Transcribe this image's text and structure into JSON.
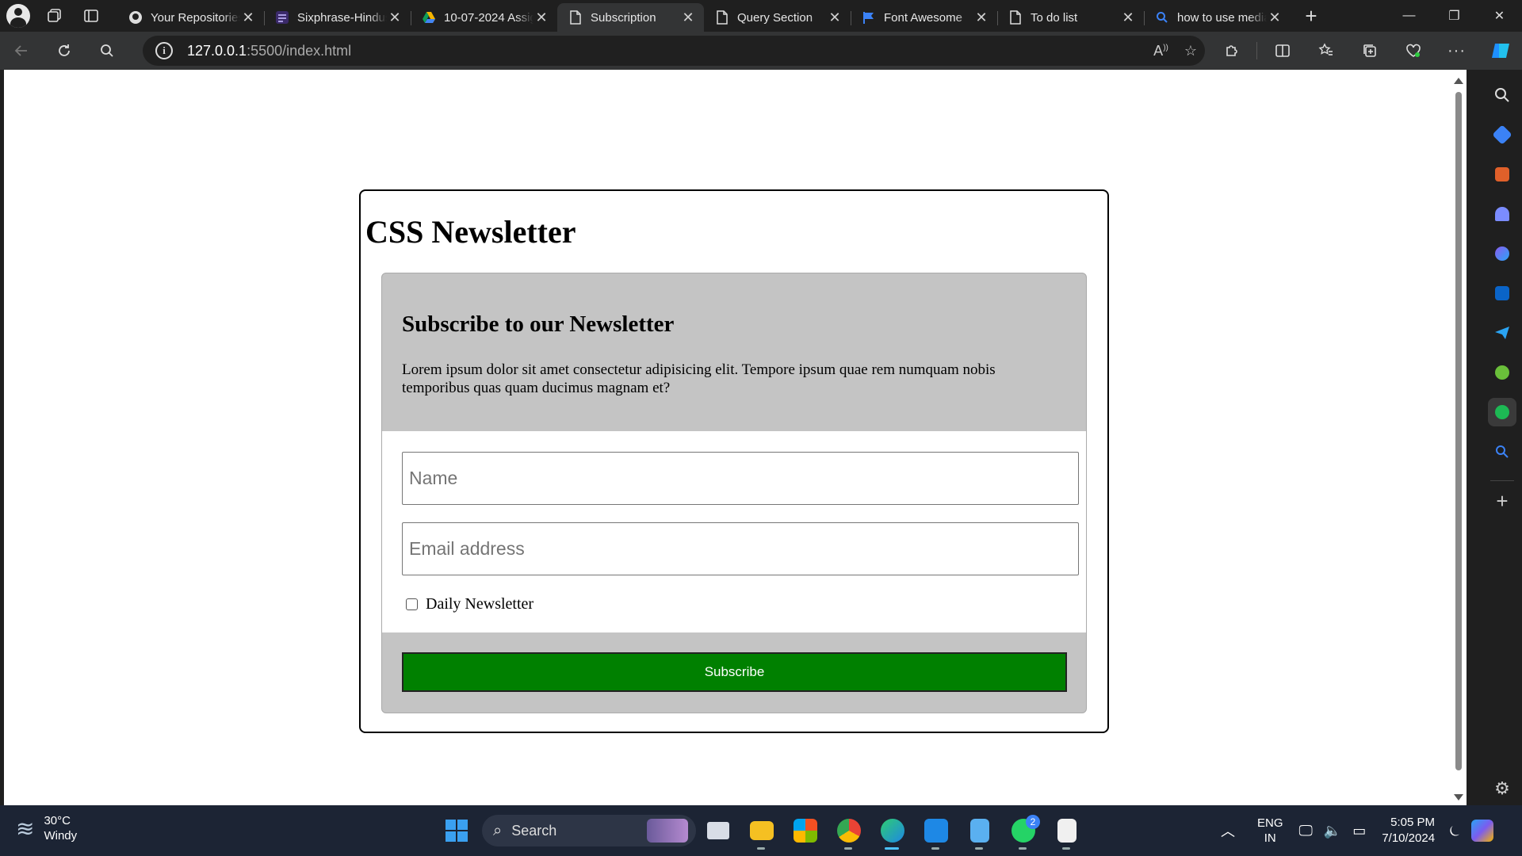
{
  "browser": {
    "tabs": [
      {
        "title": "Your Repositories",
        "favicon": "github-icon",
        "active": false
      },
      {
        "title": "Sixphrase-Hindustan",
        "favicon": "list-icon",
        "active": false
      },
      {
        "title": "10-07-2024 Assignment",
        "favicon": "google-drive-icon",
        "active": false
      },
      {
        "title": "Subscription",
        "favicon": "page-icon",
        "active": true
      },
      {
        "title": "Query Section",
        "favicon": "page-icon",
        "active": false
      },
      {
        "title": "Font Awesome",
        "favicon": "flag-icon",
        "active": false
      },
      {
        "title": "To do list",
        "favicon": "page-icon",
        "active": false
      },
      {
        "title": "how to use media",
        "favicon": "search-icon",
        "active": false
      }
    ],
    "url_host": "127.0.0.1",
    "url_rest": ":5500/index.html"
  },
  "page": {
    "heading": "CSS Newsletter",
    "signup": {
      "title": "Subscribe to our Newsletter",
      "description": "Lorem ipsum dolor sit amet consectetur adipisicing elit. Tempore ipsum quae rem numquam nobis temporibus quas quam ducimus magnam et?",
      "name_placeholder": "Name",
      "email_placeholder": "Email address",
      "checkbox_label": "Daily Newsletter",
      "checkbox_checked": false,
      "button_label": "Subscribe",
      "button_color": "#008000",
      "panel_color": "#c4c4c4"
    }
  },
  "taskbar": {
    "weather_temp": "30°C",
    "weather_desc": "Windy",
    "search_label": "Search",
    "lang_top": "ENG",
    "lang_bottom": "IN",
    "time": "5:05 PM",
    "date": "7/10/2024",
    "whatsapp_badge": "2"
  }
}
